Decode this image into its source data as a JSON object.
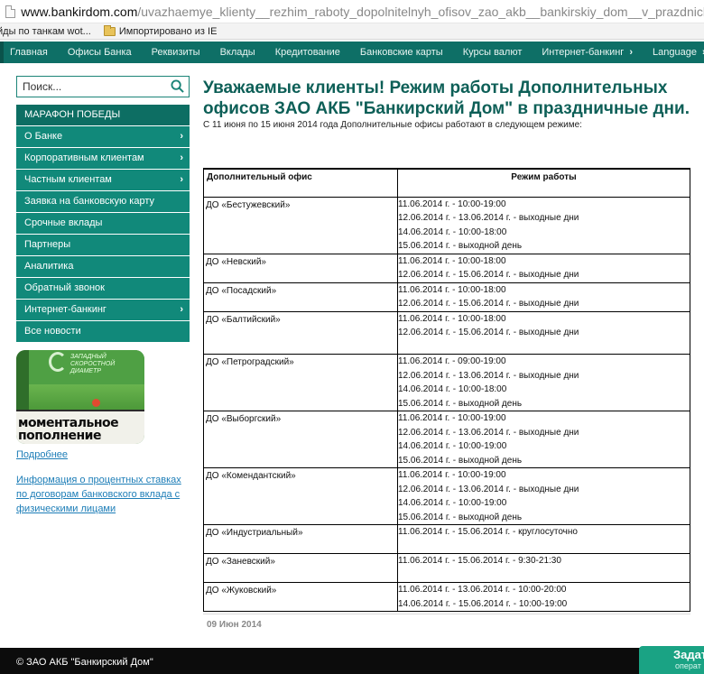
{
  "browser": {
    "url_host": "www.bankirdom.com",
    "url_path": "/uvazhaemye_klienty__rezhim_raboty_dopolnitelnyh_ofisov_zao_akb__bankirskiy_dom__v_prazdnichnye_dni_",
    "bookmarks": [
      "йды по танкам wot...",
      "Импортировано из IE"
    ]
  },
  "topnav": {
    "items": [
      "Главная",
      "Офисы Банка",
      "Реквизиты",
      "Вклады",
      "Кредитование",
      "Банковские карты",
      "Курсы валют",
      "Интернет-банкинг",
      "Language"
    ]
  },
  "sidebar": {
    "search_placeholder": "Поиск...",
    "menu": [
      {
        "label": "МАРАФОН ПОБЕДЫ",
        "arrow": false
      },
      {
        "label": "О Банке",
        "arrow": true
      },
      {
        "label": "Корпоративным клиентам",
        "arrow": true
      },
      {
        "label": "Частным клиентам",
        "arrow": true
      },
      {
        "label": "Заявка на банковскую карту",
        "arrow": false
      },
      {
        "label": "Срочные вклады",
        "arrow": false
      },
      {
        "label": "Партнеры",
        "arrow": false
      },
      {
        "label": "Аналитика",
        "arrow": false
      },
      {
        "label": "Обратный звонок",
        "arrow": false
      },
      {
        "label": "Интернет-банкинг",
        "arrow": true
      },
      {
        "label": "Все новости",
        "arrow": false
      }
    ],
    "promo": {
      "top_text": "ЗАПАДНЫЙ СКОРОСТНОЙ ДИАМЕТР",
      "bottom_text": "моментальное пополнение"
    },
    "more_link": "Подробнее",
    "info_link": "Информация о процентных ставках по договорам банковского вклада с физическими лицами"
  },
  "main": {
    "title": "Уважаемые клиенты! Режим работы Дополнительных офисов ЗАО АКБ \"Банкирский Дом\" в праздничные дни.",
    "subtitle": "С 11 июня по 15 июня 2014 года Дополнительные офисы работают в следующем режиме:",
    "table": {
      "headers": [
        "Дополнительный офис",
        "Режим работы"
      ],
      "rows": [
        {
          "office": "ДО «Бестужевский»",
          "lines": [
            "11.06.2014 г. - 10:00-19:00",
            "12.06.2014 г. - 13.06.2014 г. - выходные дни",
            "14.06.2014 г. - 10:00-18:00",
            "15.06.2014 г. - выходной день"
          ]
        },
        {
          "office": "ДО «Невский»",
          "lines": [
            "11.06.2014 г. - 10:00-18:00",
            "12.06.2014 г. - 15.06.2014 г. - выходные дни"
          ]
        },
        {
          "office": "ДО «Посадский»",
          "lines": [
            "11.06.2014 г. - 10:00-18:00",
            "12.06.2014 г. - 15.06.2014 г. - выходные дни"
          ]
        },
        {
          "office": "ДО «Балтийский»",
          "lines": [
            "11.06.2014 г. - 10:00-18:00",
            "12.06.2014 г. - 15.06.2014 г. - выходные дни",
            ""
          ]
        },
        {
          "office": "ДО «Петроградский»",
          "lines": [
            "11.06.2014 г. - 09:00-19:00",
            "12.06.2014 г. - 13.06.2014 г. - выходные дни",
            "14.06.2014 г. - 10:00-18:00",
            "15.06.2014 г. - выходной день"
          ]
        },
        {
          "office": "ДО «Выборгский»",
          "lines": [
            "11.06.2014 г. - 10:00-19:00",
            "12.06.2014 г. - 13.06.2014 г. - выходные дни",
            "14.06.2014 г. - 10:00-19:00",
            "15.06.2014 г. - выходной день"
          ]
        },
        {
          "office": "ДО «Комендантский»",
          "lines": [
            "11.06.2014 г. - 10:00-19:00",
            "12.06.2014 г. - 13.06.2014 г. - выходные дни",
            "14.06.2014 г. - 10:00-19:00",
            "15.06.2014 г. - выходной день"
          ]
        },
        {
          "office": "ДО «Индустриальный»",
          "lines": [
            "11.06.2014 г. - 15.06.2014 г. - круглосуточно",
            ""
          ]
        },
        {
          "office": "ДО «Заневский»",
          "lines": [
            "11.06.2014 г. - 15.06.2014 г. - 9:30-21:30",
            ""
          ]
        },
        {
          "office": "ДО «Жуковский»",
          "lines": [
            "11.06.2014 г. - 13.06.2014 г. - 10:00-20:00",
            "14.06.2014 г. - 15.06.2014 г. - 10:00-19:00"
          ]
        }
      ]
    },
    "date": "09 Июн 2014"
  },
  "footer": {
    "copyright": "© ЗАО АКБ \"Банкирский Дом\"",
    "ask_title": "Задат",
    "ask_sub": "операт"
  },
  "colors": {
    "nav_bg": "#0e6f66",
    "menu_bg": "#11897a",
    "title": "#0d5f57",
    "link": "#1c7db7"
  }
}
